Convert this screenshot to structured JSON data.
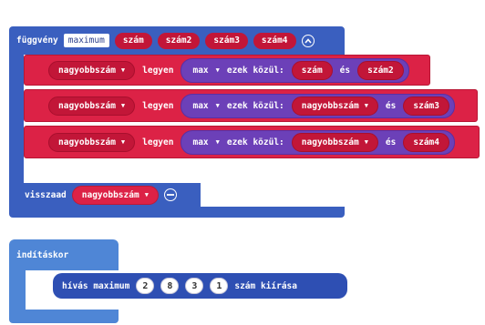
{
  "function_block": {
    "keyword": "függvény",
    "name": "maximum",
    "params": [
      "szám",
      "szám2",
      "szám3",
      "szám4"
    ],
    "collapse_icon": "chevron-up-circle-icon"
  },
  "set_statements": [
    {
      "variable": "nagyobbszám",
      "verb": "legyen",
      "op": "max",
      "phrase": "ezek közül:",
      "a": "szám",
      "and": "és",
      "b": "szám2",
      "a_has_dropdown": false
    },
    {
      "variable": "nagyobbszám",
      "verb": "legyen",
      "op": "max",
      "phrase": "ezek közül:",
      "a": "nagyobbszám",
      "and": "és",
      "b": "szám3",
      "a_has_dropdown": true
    },
    {
      "variable": "nagyobbszám",
      "verb": "legyen",
      "op": "max",
      "phrase": "ezek közül:",
      "a": "nagyobbszám",
      "and": "és",
      "b": "szám4",
      "a_has_dropdown": true
    }
  ],
  "return_statement": {
    "keyword": "visszaad",
    "value": "nagyobbszám",
    "remove_icon": "minus-circle-icon"
  },
  "start_block": {
    "label": "indításkor"
  },
  "call_statement": {
    "keyword": "hívás maximum",
    "args": [
      "2",
      "8",
      "3",
      "1"
    ],
    "suffix": "szám kiírása"
  },
  "colors": {
    "function_blue": "#3a5fbf",
    "variable_red": "#dc2246",
    "math_purple": "#6c40b8",
    "start_blue": "#4f86d6",
    "call_blue": "#2e4fb3"
  }
}
